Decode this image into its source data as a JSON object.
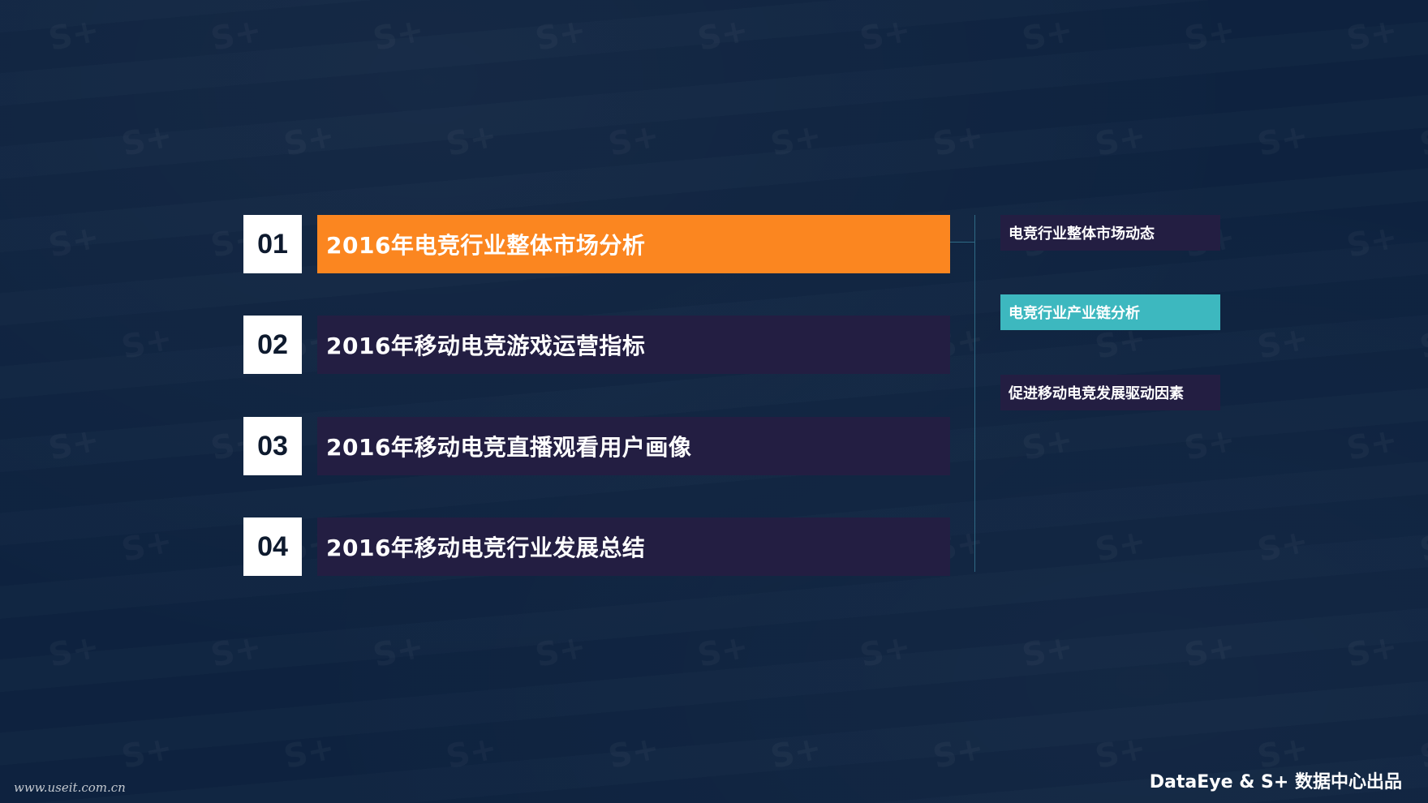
{
  "agenda": {
    "items": [
      {
        "number": "01",
        "title": "2016年电竞行业整体市场分析",
        "active": true
      },
      {
        "number": "02",
        "title": "2016年移动电竞游戏运营指标",
        "active": false
      },
      {
        "number": "03",
        "title": "2016年移动电竞直播观看用户画像",
        "active": false
      },
      {
        "number": "04",
        "title": "2016年移动电竞行业发展总结",
        "active": false
      }
    ]
  },
  "subsections": {
    "items": [
      {
        "label": "电竞行业整体市场动态",
        "highlighted": false
      },
      {
        "label": "电竞行业产业链分析",
        "highlighted": true
      },
      {
        "label": "促进移动电竞发展驱动因素",
        "highlighted": false
      }
    ]
  },
  "footer": {
    "credit": "DataEye & S+ 数据中心出品",
    "site": "www.useit.com.cn"
  },
  "watermark": "S+",
  "colors": {
    "background": "#0e2340",
    "active_orange": "#fb8620",
    "panel_purple": "#231e42",
    "highlight_teal": "#3db8bf",
    "number_box": "#ffffff"
  }
}
